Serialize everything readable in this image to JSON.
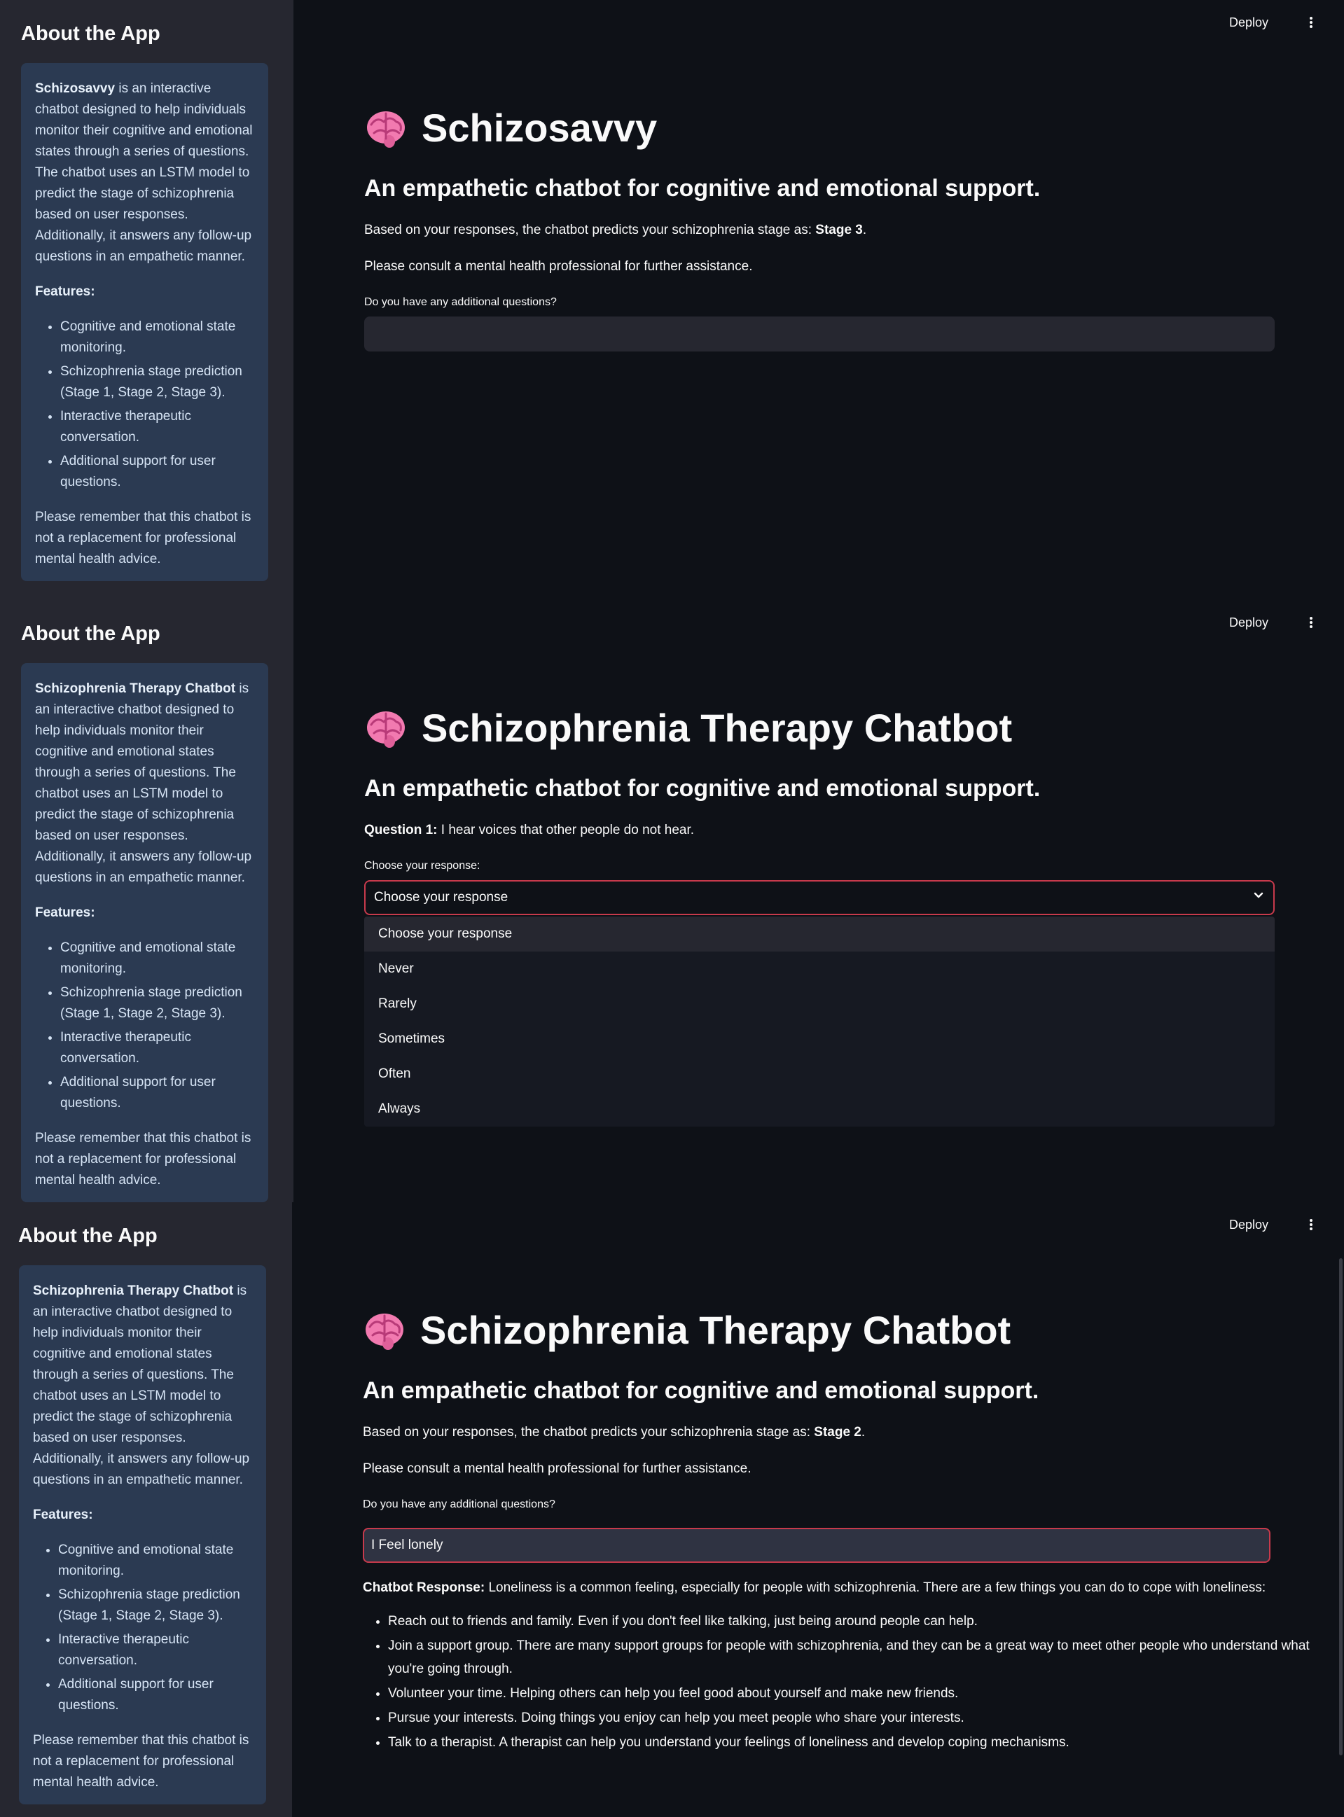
{
  "topbar": {
    "deploy_label": "Deploy"
  },
  "panel1": {
    "sidebar": {
      "title": "About the App",
      "intro_bold": "Schizosavvy",
      "intro_rest": " is an interactive chatbot designed to help individuals monitor their cognitive and emotional states through a series of questions. The chatbot uses an LSTM model to predict the stage of schizophrenia based on user responses. Additionally, it answers any follow-up questions in an empathetic manner.",
      "features_heading": "Features:",
      "features": [
        "Cognitive and emotional state monitoring.",
        "Schizophrenia stage prediction (Stage 1, Stage 2, Stage 3).",
        "Interactive therapeutic conversation.",
        "Additional support for user questions."
      ],
      "disclaimer": "Please remember that this chatbot is not a replacement for professional mental health advice."
    },
    "main": {
      "title": "Schizosavvy",
      "subtitle": "An empathetic chatbot for cognitive and emotional support.",
      "prediction_text": "Based on your responses, the chatbot predicts your schizophrenia stage as: ",
      "prediction_stage": "Stage 3",
      "prediction_end": ".",
      "consult_text": "Please consult a mental health professional for further assistance.",
      "question_label": "Do you have any additional questions?",
      "question_value": ""
    }
  },
  "panel2": {
    "sidebar": {
      "title": "About the App",
      "intro_bold": "Schizophrenia Therapy Chatbot",
      "intro_rest": " is an interactive chatbot designed to help individuals monitor their cognitive and emotional states through a series of questions. The chatbot uses an LSTM model to predict the stage of schizophrenia based on user responses. Additionally, it answers any follow-up questions in an empathetic manner.",
      "features_heading": "Features:",
      "features": [
        "Cognitive and emotional state monitoring.",
        "Schizophrenia stage prediction (Stage 1, Stage 2, Stage 3).",
        "Interactive therapeutic conversation.",
        "Additional support for user questions."
      ],
      "disclaimer": "Please remember that this chatbot is not a replacement for professional mental health advice."
    },
    "main": {
      "title": "Schizophrenia Therapy Chatbot",
      "subtitle": "An empathetic chatbot for cognitive and emotional support.",
      "question_prefix": "Question 1:",
      "question_text": " I hear voices that other people do not hear.",
      "select_label": "Choose your response:",
      "select_value": "Choose your response",
      "options": [
        "Choose your response",
        "Never",
        "Rarely",
        "Sometimes",
        "Often",
        "Always"
      ]
    }
  },
  "panel3": {
    "sidebar": {
      "title": "About the App",
      "intro_bold": "Schizophrenia Therapy Chatbot",
      "intro_rest": " is an interactive chatbot designed to help individuals monitor their cognitive and emotional states through a series of questions. The chatbot uses an LSTM model to predict the stage of schizophrenia based on user responses. Additionally, it answers any follow-up questions in an empathetic manner.",
      "features_heading": "Features:",
      "features": [
        "Cognitive and emotional state monitoring.",
        "Schizophrenia stage prediction (Stage 1, Stage 2, Stage 3).",
        "Interactive therapeutic conversation.",
        "Additional support for user questions."
      ],
      "disclaimer": "Please remember that this chatbot is not a replacement for professional mental health advice."
    },
    "main": {
      "title": "Schizophrenia Therapy Chatbot",
      "subtitle": "An empathetic chatbot for cognitive and emotional support.",
      "prediction_text": "Based on your responses, the chatbot predicts your schizophrenia stage as: ",
      "prediction_stage": "Stage 2",
      "prediction_end": ".",
      "consult_text": "Please consult a mental health professional for further assistance.",
      "question_label": "Do you have any additional questions?",
      "question_value": "I Feel lonely",
      "response_label": "Chatbot Response:",
      "response_text": " Loneliness is a common feeling, especially for people with schizophrenia. There are a few things you can do to cope with loneliness:",
      "response_items": [
        "Reach out to friends and family. Even if you don't feel like talking, just being around people can help.",
        "Join a support group. There are many support groups for people with schizophrenia, and they can be a great way to meet other people who understand what you're going through.",
        "Volunteer your time. Helping others can help you feel good about yourself and make new friends.",
        "Pursue your interests. Doing things you enjoy can help you meet people who share your interests.",
        "Talk to a therapist. A therapist can help you understand your feelings of loneliness and develop coping mechanisms."
      ]
    }
  },
  "colors": {
    "background": "#0e1117",
    "sidebar": "#262730",
    "info_box": "#2b3a52",
    "accent_border": "#c73a4c",
    "brain_icon": "#f27ab0"
  }
}
